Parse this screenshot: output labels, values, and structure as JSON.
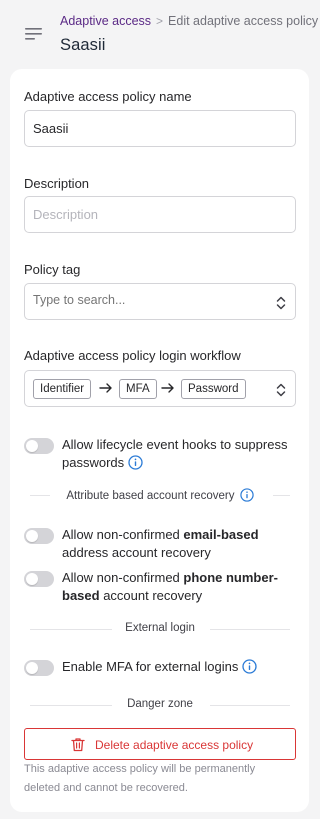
{
  "breadcrumb": {
    "parent": "Adaptive access",
    "separator": ">",
    "current": "Edit adaptive access policy"
  },
  "page_title": "Saasii",
  "form": {
    "policy_name": {
      "label": "Adaptive access policy name",
      "value": "Saasii"
    },
    "description": {
      "label": "Description",
      "value": "",
      "placeholder": "Description"
    },
    "policy_tag": {
      "label": "Policy tag",
      "placeholder": "Type to search..."
    },
    "workflow": {
      "label": "Adaptive access policy login workflow",
      "steps": [
        "Identifier",
        "MFA",
        "Password"
      ]
    }
  },
  "toggles": {
    "lifecycle_hooks": {
      "text": "Allow lifecycle event hooks to suppress passwords",
      "enabled": false
    },
    "email_recovery": {
      "text_before": "Allow non-confirmed ",
      "text_bold": "email-based",
      "text_after": " address account recovery",
      "enabled": false
    },
    "phone_recovery": {
      "text_before": "Allow non-confirmed ",
      "text_bold": "phone number-based",
      "text_after": " account recovery",
      "enabled": false
    },
    "external_mfa": {
      "text": "Enable MFA for external logins",
      "enabled": false
    }
  },
  "sections": {
    "attribute_recovery": "Attribute based account recovery",
    "external_login": "External login",
    "danger_zone": "Danger zone"
  },
  "danger": {
    "button_label": "Delete adaptive access policy",
    "note": "This adaptive access policy will be permanently deleted and cannot be recovered."
  },
  "colors": {
    "accent": "#5b2a86",
    "info": "#2b7bd6",
    "danger": "#d93636",
    "toggle_off": "#d4d4d8"
  },
  "icons": [
    "menu-icon",
    "chevron-right-icon",
    "chevrons-up-down-icon",
    "arrow-right-icon",
    "info-icon",
    "trash-icon"
  ]
}
